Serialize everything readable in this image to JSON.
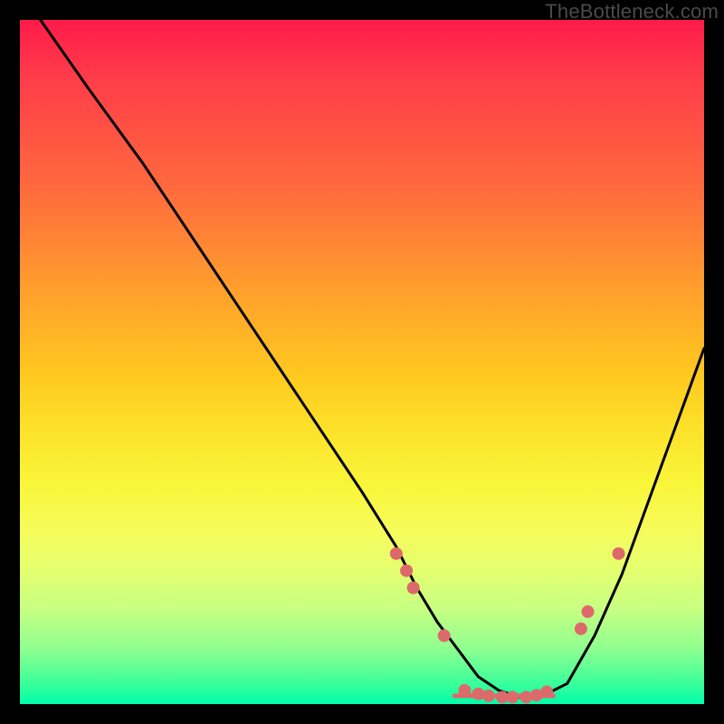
{
  "watermark": "TheBottleneck.com",
  "colors": {
    "marker": "#dd6a6a",
    "curve": "#000000"
  },
  "chart_data": {
    "type": "line",
    "title": "",
    "xlabel": "",
    "ylabel": "",
    "xlim": [
      0,
      100
    ],
    "ylim": [
      0,
      100
    ],
    "grid": false,
    "curve": {
      "x": [
        3,
        10,
        18,
        26,
        34,
        42,
        50,
        55,
        58,
        61,
        64,
        67,
        70,
        73,
        76,
        80,
        84,
        88,
        92,
        96,
        100
      ],
      "y": [
        100,
        90,
        79,
        67,
        55,
        43,
        31,
        23,
        17,
        12,
        8,
        4,
        2,
        1,
        1,
        3,
        10,
        19,
        30,
        41,
        52
      ]
    },
    "markers": [
      {
        "x": 55.0,
        "y": 22.0
      },
      {
        "x": 56.5,
        "y": 19.5
      },
      {
        "x": 57.5,
        "y": 17.0
      },
      {
        "x": 62.0,
        "y": 10.0
      },
      {
        "x": 65.0,
        "y": 2.0
      },
      {
        "x": 67.0,
        "y": 1.5
      },
      {
        "x": 68.5,
        "y": 1.2
      },
      {
        "x": 70.5,
        "y": 1.0
      },
      {
        "x": 72.0,
        "y": 1.0
      },
      {
        "x": 74.0,
        "y": 1.0
      },
      {
        "x": 75.5,
        "y": 1.3
      },
      {
        "x": 77.0,
        "y": 1.8
      },
      {
        "x": 82.0,
        "y": 11.0
      },
      {
        "x": 83.0,
        "y": 13.5
      },
      {
        "x": 87.5,
        "y": 22.0
      }
    ],
    "floor_segment": {
      "x_start": 63.5,
      "x_end": 78.0,
      "y": 1.2
    }
  }
}
